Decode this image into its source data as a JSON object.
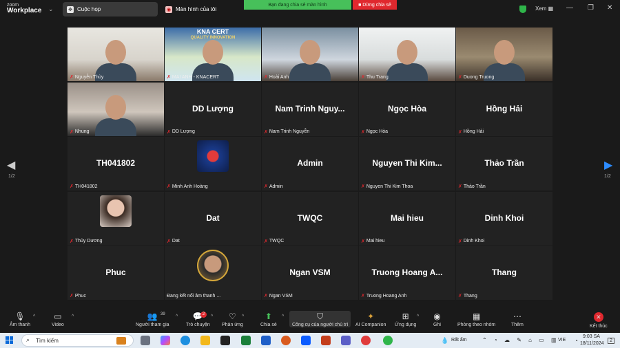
{
  "app": {
    "logo_line1": "zoom",
    "logo_line2": "Workplace"
  },
  "tabs": [
    {
      "label": "Cuộc họp",
      "icon": "meeting-icon"
    },
    {
      "label": "Màn hình của tôi",
      "icon": "screen-icon"
    }
  ],
  "share_bar": {
    "sharing_text": "Bạn đang chia sẻ màn hình",
    "stop_label": "Dừng chia sẻ"
  },
  "window": {
    "view_label": "Xem"
  },
  "pager": {
    "left": "1/2",
    "right": "1/2"
  },
  "tiles": [
    {
      "name": "Nguyễn Thùy",
      "big": "",
      "video": true
    },
    {
      "name": "MAI ANH - KNACERT",
      "big": "",
      "video": true,
      "active": true,
      "banner": "KNA CERT",
      "banner_sub": "QUALITY INNOVATION"
    },
    {
      "name": "Hoài Anh",
      "big": "",
      "video": true
    },
    {
      "name": "Thu Trang",
      "big": "",
      "video": true
    },
    {
      "name": "Duong Truong",
      "big": "",
      "video": true
    },
    {
      "name": "Nhung",
      "big": "",
      "video": true
    },
    {
      "name": "DD Lượng",
      "big": "DD Lượng"
    },
    {
      "name": "Nam Trinh Nguyễn",
      "big": "Nam Trinh Nguy..."
    },
    {
      "name": "Ngọc Hòa",
      "big": "Ngọc Hòa"
    },
    {
      "name": "Hồng Hải",
      "big": "Hồng Hải"
    },
    {
      "name": "TH041802",
      "big": "TH041802"
    },
    {
      "name": "Minh Anh Hoàng",
      "big": "",
      "avatar": "flower"
    },
    {
      "name": "Admin",
      "big": "Admin"
    },
    {
      "name": "Nguyen Thi Kim Thoa",
      "big": "Nguyen Thi Kim..."
    },
    {
      "name": "Thảo Trần",
      "big": "Thảo Trần"
    },
    {
      "name": "Thủy Dương",
      "big": "",
      "avatar": "girl"
    },
    {
      "name": "Dat",
      "big": "Dat"
    },
    {
      "name": "TWQC",
      "big": "TWQC"
    },
    {
      "name": "Mai hieu",
      "big": "Mai hieu"
    },
    {
      "name": "Dinh Khoi",
      "big": "Dinh Khoi"
    },
    {
      "name": "Phuc",
      "big": "Phuc"
    },
    {
      "name": "Đang kết nối âm thanh ...",
      "big": "",
      "avatar": "boy",
      "no_mute": true
    },
    {
      "name": "Ngan VSM",
      "big": "Ngan VSM"
    },
    {
      "name": "Truong Hoang Anh",
      "big": "Truong Hoang A..."
    },
    {
      "name": "Thang",
      "big": "Thang"
    }
  ],
  "toolbar": {
    "audio": "Âm thanh",
    "video": "Video",
    "participants": "Người tham gia",
    "participants_count": "39",
    "chat": "Trò chuyện",
    "chat_badge": "2",
    "react": "Phản ứng",
    "share": "Chia sẻ",
    "host_tools": "Công cụ của người chủ trì",
    "ai": "AI Companion",
    "apps": "Ứng dụng",
    "record": "Ghi",
    "breakout": "Phòng theo nhóm",
    "more": "Thêm",
    "end": "Kết thúc"
  },
  "taskbar": {
    "search_placeholder": "Tìm kiếm",
    "weather": "Rất ẩm",
    "lang": "VIE",
    "time": "9:03 SA",
    "date": "18/11/2024",
    "notif": "2"
  },
  "colors": {
    "accent": "#2d8cff",
    "share_green": "#47c05a",
    "stop_red": "#e0282e",
    "active_border": "#39d06a"
  }
}
